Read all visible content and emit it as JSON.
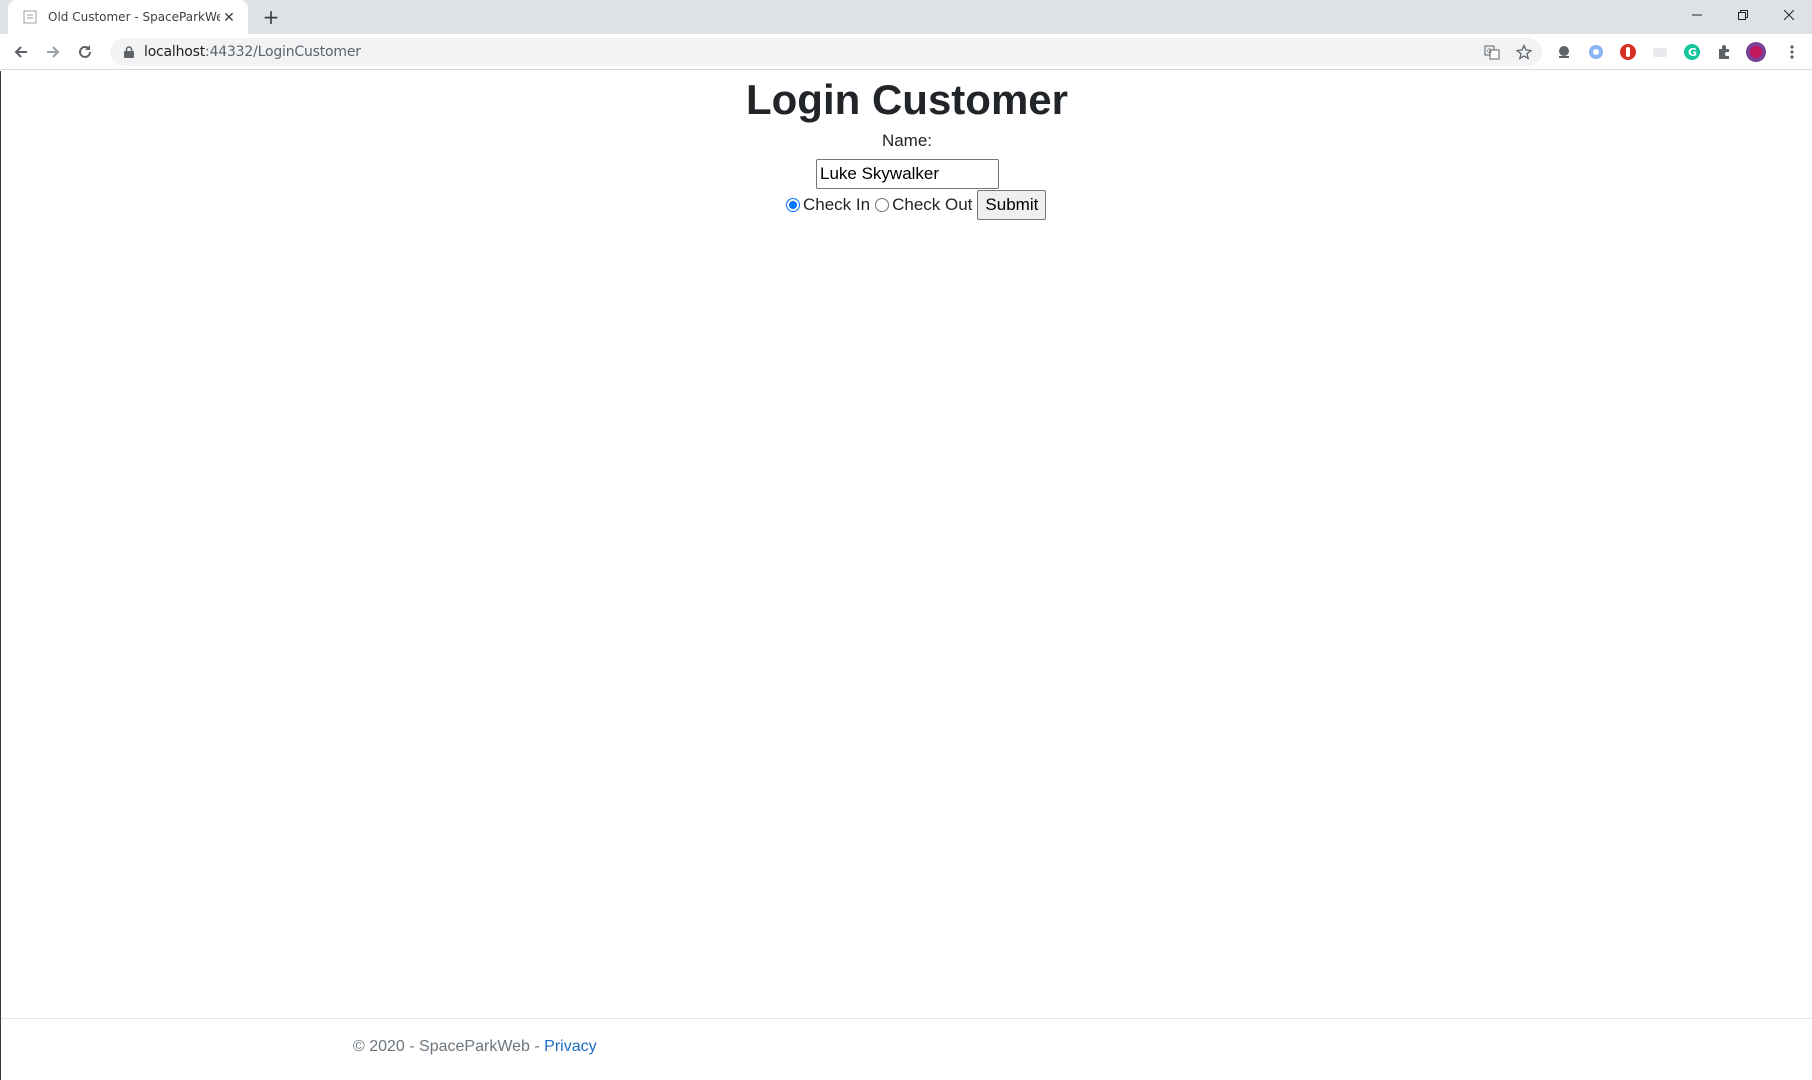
{
  "browser": {
    "tab_title": "Old Customer - SpaceParkWeb",
    "url_host": "localhost",
    "url_rest": ":44332/LoginCustomer"
  },
  "page": {
    "title": "Login Customer",
    "name_label": "Name:",
    "name_value": "Luke Skywalker",
    "radio_check_in": "Check In",
    "radio_check_out": "Check Out",
    "selected_option": "Check In",
    "submit_label": "Submit"
  },
  "footer": {
    "copyright": "© 2020 - SpaceParkWeb - ",
    "privacy_link": "Privacy"
  },
  "colors": {
    "link": "#1b6ec2",
    "radio_accent": "#0075ff"
  }
}
